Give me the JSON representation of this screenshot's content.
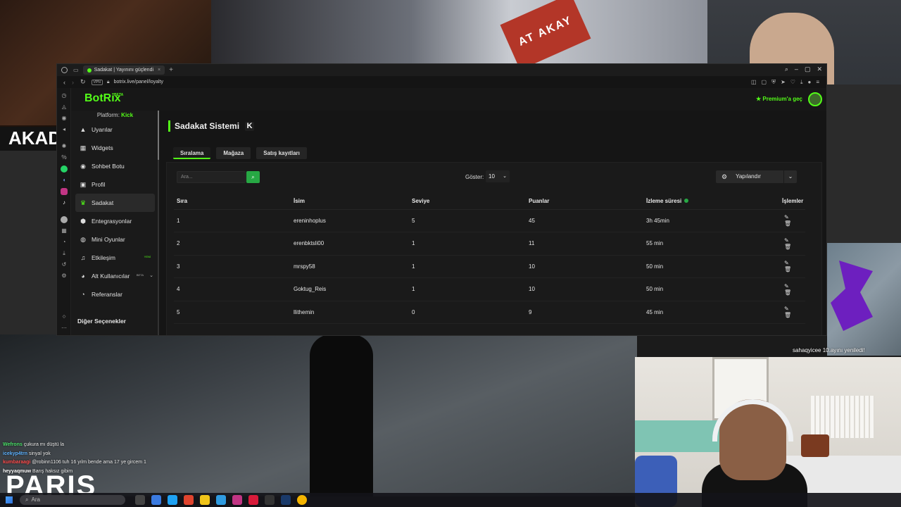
{
  "stream": {
    "overlay_left": "AKAD",
    "overlay_bottom": "PARIS",
    "sign_text": "AT AKAY",
    "renewal_text": "sahaqyicee 10.ayını yeniledi!",
    "chat": [
      {
        "user": "Wefrons",
        "text": "çukura mı düştü la"
      },
      {
        "user": "icekyp4trn",
        "text": "sinyal yok"
      },
      {
        "user": "kumbaraagi",
        "text": "@robinn1106 tuh 16 yılm bende ama 17 ye gircem 1"
      },
      {
        "user": "heyyaqmuw",
        "text": "Barış haksız gibim"
      },
      {
        "user": "",
        "text": ""
      }
    ]
  },
  "taskbar": {
    "search_placeholder": "Ara"
  },
  "browser": {
    "tab_title": "Sadakat | Yayınını güçlendi",
    "vpn_label": "VPN",
    "url": "botrix.live/panel/loyalty"
  },
  "app": {
    "logo": "BotRix",
    "logo_badge": "BETA",
    "premium_label": "Premium'a geç",
    "platform_label": "Platform:",
    "platform_value": "Kick",
    "menu": [
      {
        "label": "Uyarılar",
        "icon": "warning-icon"
      },
      {
        "label": "Widgets",
        "icon": "widgets-icon"
      },
      {
        "label": "Sohbet Botu",
        "icon": "robot-icon"
      },
      {
        "label": "Profil",
        "icon": "profile-icon"
      },
      {
        "label": "Sadakat",
        "icon": "trophy-icon"
      },
      {
        "label": "Entegrasyonlar",
        "icon": "integrations-icon"
      },
      {
        "label": "Mini Oyunlar",
        "icon": "gamepad-icon"
      },
      {
        "label": "Etkileşim",
        "icon": "music-icon",
        "badge": "YENİ"
      },
      {
        "label": "Alt Kullanıcılar",
        "icon": "users-icon",
        "badge": "BETA"
      },
      {
        "label": "Referanslar",
        "icon": "referral-icon"
      }
    ],
    "other_options": "Diğer Seçenekler",
    "page_title": "Sadakat Sistemi",
    "tabs": [
      "Sıralama",
      "Mağaza",
      "Satış kayıtları"
    ],
    "search_placeholder": "Ara...",
    "show_label": "Göster:",
    "show_value": "10",
    "configure_label": "Yapılandır",
    "table": {
      "headers": [
        "Sıra",
        "İsim",
        "Seviye",
        "Puanlar",
        "İzleme süresi",
        "İşlemler"
      ],
      "rows": [
        [
          "1",
          "ereninhoplus",
          "5",
          "45",
          "3h 45min"
        ],
        [
          "2",
          "erenbktsli00",
          "1",
          "11",
          "55 min"
        ],
        [
          "3",
          "mrspy58",
          "1",
          "10",
          "50 min"
        ],
        [
          "4",
          "Goktug_Reis",
          "1",
          "10",
          "50 min"
        ],
        [
          "5",
          "llithemin",
          "0",
          "9",
          "45 min"
        ]
      ]
    }
  },
  "colors": {
    "accent": "#53fc18",
    "search_button": "#27a844",
    "background": "#151515"
  }
}
